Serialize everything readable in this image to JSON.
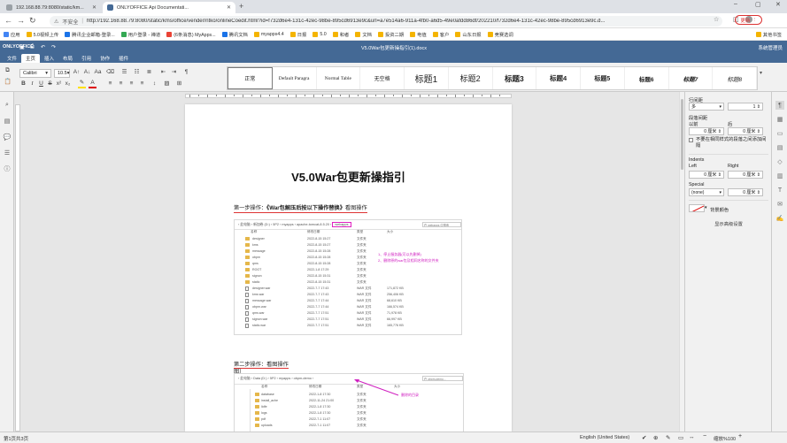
{
  "browser": {
    "tabs": [
      {
        "label": "192.168.88.79:8080/static/km..."
      },
      {
        "label": "ONLYOFFICE Api Documentati..."
      }
    ],
    "security_label": "不安全",
    "url": "http://192.168.88.79:8080/static/kms/office/vender/ntko/onlineCoedit.html?id=f732d6e4-131c-42ec-98be-895cd6913e9c&url=a7e514a6-911a-4fb0-a6d5-49e0afdd86df/202210/f732d6e4-131c-42ec-98be-895cd6913e9c.d...",
    "update_label": "更新",
    "bookmarks": [
      "应用",
      "5.0视频上传",
      "腾讯企业邮箱-登录...",
      "用户登录 - 禅道",
      "(6条消息) MyApps...",
      "腾讯文档",
      "myapps4.4",
      "日报",
      "5.0",
      "和者",
      "文档",
      "投资二期",
      "电值",
      "客户",
      "山东日报",
      "竞赛选调"
    ],
    "other_bookmarks": "其他书签"
  },
  "editor": {
    "brand": "ONLYOFFICE",
    "doc_title": "V5.0War包更新操指引(1).docx",
    "user": "系统管理员",
    "menu": [
      "文件",
      "主页",
      "插入",
      "布局",
      "引用",
      "协作",
      "插件"
    ],
    "active_menu": "主页",
    "font_name": "Calibri",
    "font_size": "10.5",
    "styles": [
      "正常",
      "Default Paragra",
      "Normal Table",
      "无空格",
      "标题1",
      "标题2",
      "标题3",
      "标题4",
      "标题5",
      "标题6",
      "标题7",
      "标题8"
    ]
  },
  "document": {
    "title": "V5.0War包更新操指引",
    "step1_prefix": "第一步操作：",
    "step1_bold": "《War包解压后按以下操作替换》",
    "step1_suffix": "看图操作",
    "step2_line1": "第二步操作：看图操作",
    "step2_line2": "图）",
    "shot1": {
      "breadcrumb": "› 此电脑 › 新加卷 (D:) › 5P2 › myapps › apache-tomcat-8.5.20 ›",
      "breadcrumb_highlight": "webapps",
      "search": "在 webapps 中搜索",
      "headers": [
        "名称",
        "修改日期",
        "类型",
        "大小"
      ],
      "annot1": "1、停止服务器(可以先删掉)",
      "annot2": "2、删除原的war包及相同名称的文件夹",
      "rows": [
        {
          "kind": "folder",
          "name": "designer",
          "date": "2022-8-15 15:27",
          "type": "文件夹",
          "size": ""
        },
        {
          "kind": "folder",
          "name": "kms",
          "date": "2022-8-15 15:27",
          "type": "文件夹",
          "size": ""
        },
        {
          "kind": "folder",
          "name": "message",
          "date": "2022-8-15 15:28",
          "type": "文件夹",
          "size": ""
        },
        {
          "kind": "folder",
          "name": "obpm",
          "date": "2022-8-15 15:28",
          "type": "文件夹",
          "size": ""
        },
        {
          "kind": "folder",
          "name": "qms",
          "date": "2022-8-15 15:28",
          "type": "文件夹",
          "size": ""
        },
        {
          "kind": "folder",
          "name": "ROOT",
          "date": "2022-1-8 17:29",
          "type": "文件夹",
          "size": ""
        },
        {
          "kind": "folder",
          "name": "signon",
          "date": "2022-8-15 15:31",
          "type": "文件夹",
          "size": ""
        },
        {
          "kind": "folder",
          "name": "static",
          "date": "2022-8-15 15:31",
          "type": "文件夹",
          "size": ""
        },
        {
          "kind": "file",
          "name": "designer.war",
          "date": "2022-7-7 17:43",
          "type": "WAR 文件",
          "size": "171,872 KB"
        },
        {
          "kind": "file",
          "name": "kms.war",
          "date": "2022-7-7 17:43",
          "type": "WAR 文件",
          "size": "256,406 KB"
        },
        {
          "kind": "file",
          "name": "message.war",
          "date": "2022-7-7 17:44",
          "type": "WAR 文件",
          "size": "68,610 KB"
        },
        {
          "kind": "file",
          "name": "obpm.war",
          "date": "2022-7-7 17:44",
          "type": "WAR 文件",
          "size": "166,574 KB"
        },
        {
          "kind": "file",
          "name": "qms.war",
          "date": "2022-7-7 17:51",
          "type": "WAR 文件",
          "size": "71,978 KB"
        },
        {
          "kind": "file",
          "name": "signon.war",
          "date": "2022-7-7 17:51",
          "type": "WAR 文件",
          "size": "66,997 KB"
        },
        {
          "kind": "file",
          "name": "static.war",
          "date": "2022-7-7 17:51",
          "type": "WAR 文件",
          "size": "165,776 KB"
        }
      ]
    },
    "shot2": {
      "breadcrumb": "› 此电脑 › Data (D:) › 5P2 › myapps › obpm-demo ›",
      "search": "在 obpm-demo...",
      "headers": [
        "名称",
        "修改日期",
        "类型",
        "大小"
      ],
      "annot": "删除的目录",
      "rows": [
        {
          "name": "database",
          "date": "2022-1-8 17:30",
          "type": "文件夹"
        },
        {
          "name": "install_ache",
          "date": "2022-11-24 21:00",
          "type": "文件夹"
        },
        {
          "name": "lidfe",
          "date": "2022-1-8 17:30",
          "type": "文件夹"
        },
        {
          "name": "logs",
          "date": "2022-1-8 17:30",
          "type": "文件夹"
        },
        {
          "name": "pdf",
          "date": "2022-7-1 11:07",
          "type": "文件夹"
        },
        {
          "name": "uploads",
          "date": "2022-7-1 11:07",
          "type": "文件夹"
        }
      ]
    }
  },
  "right_panel": {
    "line_spacing_label": "行间距",
    "line_spacing_mode": "多",
    "line_spacing_value": "1",
    "para_spacing_label": "段落间距",
    "before_label": "以前",
    "after_label": "后",
    "before_value": "0 厘米",
    "after_value": "0 厘米",
    "no_space_label": "不要在相同样式的段落之间添加间隔",
    "indents_label": "Indents",
    "left_label": "Left",
    "right_label": "Right",
    "left_value": "0 厘米",
    "right_value": "0 厘米",
    "special_label": "Special",
    "special_value": "(none)",
    "special_amount": "0 厘米",
    "bg_color_label": "背景颜色",
    "advanced_label": "显示高级设置"
  },
  "status": {
    "page_info": "第1页共3页",
    "language": "English (United States)",
    "zoom": "缩放%100"
  }
}
